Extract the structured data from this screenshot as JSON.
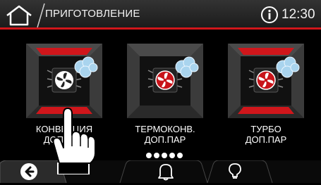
{
  "header": {
    "title": "ПРИГОТОВЛЕНИЕ",
    "time": "12:30"
  },
  "modes": [
    {
      "label_line1": "КОНВЕКЦИЯ",
      "label_line2": "ДОП.ПАР",
      "fan_color": "#222222"
    },
    {
      "label_line1": "ТЕРМОКОНВ.",
      "label_line2": "ДОП.ПАР",
      "fan_color": "#c8141a"
    },
    {
      "label_line1": "ТУРБО",
      "label_line2": "ДОП.ПАР",
      "fan_color": "#c8141a"
    }
  ],
  "page_indicator": {
    "count": 5
  },
  "colors": {
    "accent": "#d0161b",
    "steam": "#a9d4ee"
  },
  "icons": [
    "home-icon",
    "info-icon",
    "back-icon",
    "bell-icon",
    "bulb-icon",
    "hand-pointer-icon"
  ]
}
